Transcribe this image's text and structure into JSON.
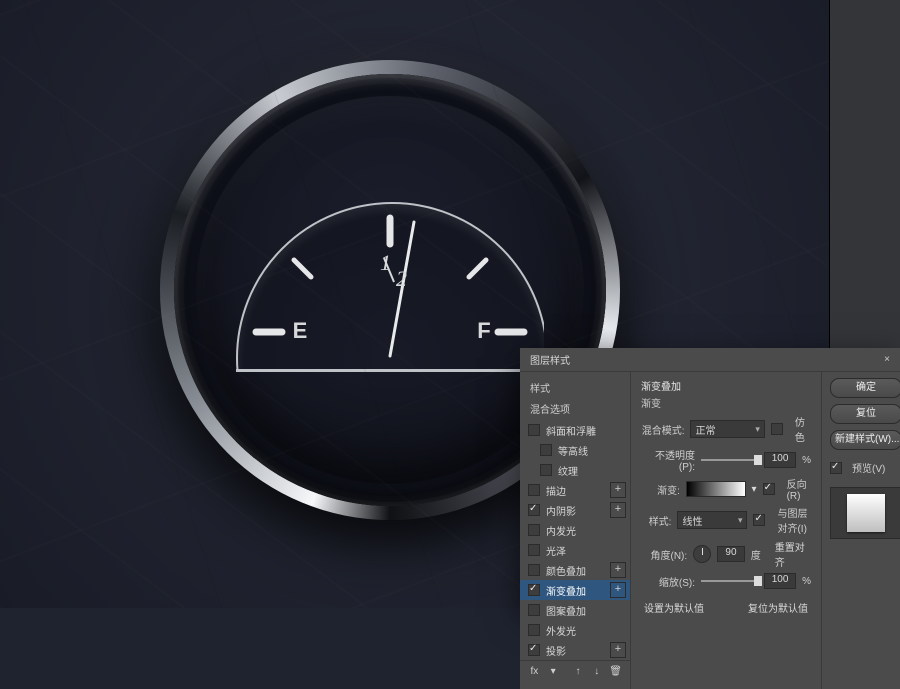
{
  "gauge": {
    "empty_label": "E",
    "full_label": "F",
    "half_numer": "1",
    "half_denom": "2"
  },
  "dialog": {
    "title": "图层样式",
    "close": "×",
    "left": {
      "header_styles": "样式",
      "blending_options": "混合选项",
      "rows": [
        {
          "label": "斜面和浮雕",
          "checked": false,
          "plus": false
        },
        {
          "label": "等高线",
          "checked": false,
          "plus": false,
          "indent": true
        },
        {
          "label": "纹理",
          "checked": false,
          "plus": false,
          "indent": true
        },
        {
          "label": "描边",
          "checked": false,
          "plus": true
        },
        {
          "label": "内阴影",
          "checked": true,
          "plus": true
        },
        {
          "label": "内发光",
          "checked": false,
          "plus": false
        },
        {
          "label": "光泽",
          "checked": false,
          "plus": false
        },
        {
          "label": "颜色叠加",
          "checked": false,
          "plus": true
        },
        {
          "label": "渐变叠加",
          "checked": true,
          "plus": true,
          "selected": true
        },
        {
          "label": "图案叠加",
          "checked": false,
          "plus": false
        },
        {
          "label": "外发光",
          "checked": false,
          "plus": false
        },
        {
          "label": "投影",
          "checked": true,
          "plus": true
        }
      ]
    },
    "mid": {
      "section": "渐变叠加",
      "subsection": "渐变",
      "blend_mode": {
        "label": "混合模式:",
        "value": "正常"
      },
      "dither": {
        "label": "仿色",
        "checked": false
      },
      "opacity": {
        "label": "不透明度(P):",
        "value": "100",
        "suffix": "%"
      },
      "gradient": {
        "label": "渐变:"
      },
      "reverse": {
        "label": "反向(R)",
        "checked": true
      },
      "style": {
        "label": "样式:",
        "value": "线性"
      },
      "align_layer": {
        "label": "与图层对齐(I)",
        "checked": true
      },
      "angle": {
        "label": "角度(N):",
        "value": "90",
        "unit": "度"
      },
      "reset_align": "重置对齐",
      "scale": {
        "label": "缩放(S):",
        "value": "100",
        "suffix": "%"
      },
      "make_default": "设置为默认值",
      "reset_default": "复位为默认值"
    },
    "right": {
      "ok": "确定",
      "cancel": "复位",
      "new_style": "新建样式(W)...",
      "preview": {
        "label": "预览(V)",
        "checked": true
      }
    }
  }
}
